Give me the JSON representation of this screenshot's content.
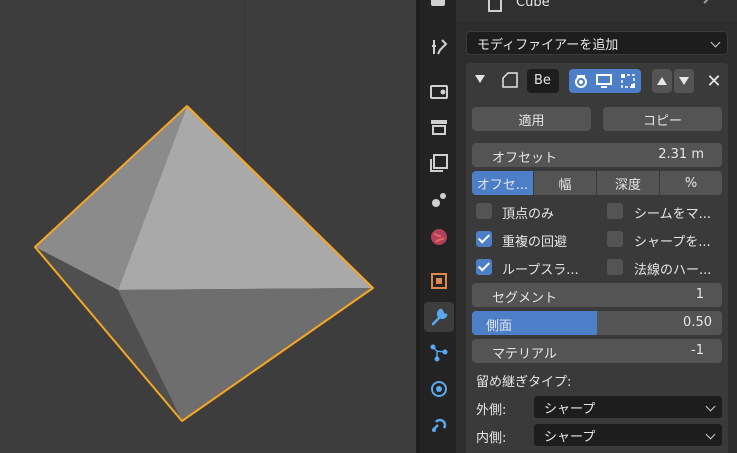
{
  "header": {
    "object_name": "Cube"
  },
  "modifier_add": {
    "label": "モディファイアーを追加"
  },
  "modifier": {
    "name": "Be",
    "apply_label": "適用",
    "copy_label": "コピー",
    "offset": {
      "label": "オフセット",
      "value": "2.31 m"
    },
    "width_type": {
      "options": [
        "オフセ...",
        "幅",
        "深度",
        "%"
      ],
      "selected_index": 0
    },
    "checks": {
      "vertex_only": {
        "label": "頂点のみ",
        "checked": false
      },
      "seam": {
        "label": "シームをマ...",
        "checked": false
      },
      "clamp_overlap": {
        "label": "重複の回避",
        "checked": true
      },
      "sharp": {
        "label": "シャープを...",
        "checked": false
      },
      "loop_slide": {
        "label": "ループスラ...",
        "checked": true
      },
      "harden_normals": {
        "label": "法線のハー...",
        "checked": false
      }
    },
    "segments": {
      "label": "セグメント",
      "value": "1"
    },
    "profile": {
      "label": "側面",
      "value": "0.50",
      "fraction": 0.5
    },
    "material": {
      "label": "マテリアル",
      "value": "-1"
    },
    "miter_title": "留め継ぎタイプ:",
    "miter_outer": {
      "label": "外側:",
      "value": "シャープ"
    },
    "miter_inner": {
      "label": "内側:",
      "value": "シャープ"
    }
  },
  "colors": {
    "accent": "#4d7fc9",
    "selection_outline": "#f5a623",
    "panel": "#2d2d2d"
  }
}
